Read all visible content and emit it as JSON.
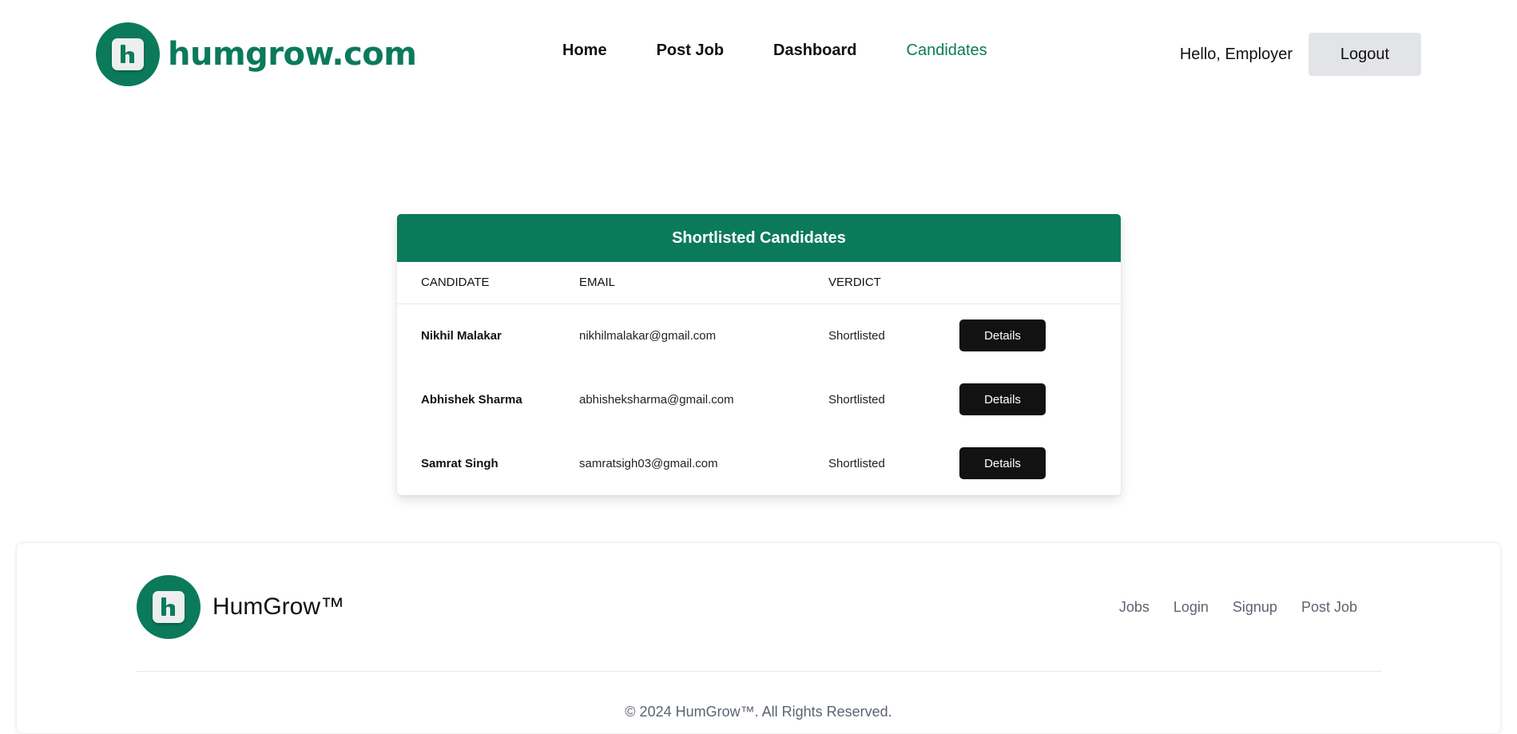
{
  "header": {
    "brand_name": "humgrow.com",
    "nav": [
      {
        "label": "Home"
      },
      {
        "label": "Post Job"
      },
      {
        "label": "Dashboard"
      },
      {
        "label": "Candidates"
      }
    ],
    "active_nav": "Candidates",
    "greeting": "Hello, Employer",
    "logout_label": "Logout"
  },
  "card": {
    "title": "Shortlisted Candidates",
    "columns": [
      "CANDIDATE",
      "EMAIL",
      "VERDICT"
    ],
    "rows": [
      {
        "name": "Nikhil Malakar",
        "email": "nikhilmalakar@gmail.com",
        "verdict": "Shortlisted",
        "action": "Details"
      },
      {
        "name": "Abhishek Sharma",
        "email": "abhisheksharma@gmail.com",
        "verdict": "Shortlisted",
        "action": "Details"
      },
      {
        "name": "Samrat Singh",
        "email": "samratsigh03@gmail.com",
        "verdict": "Shortlisted",
        "action": "Details"
      }
    ]
  },
  "footer": {
    "brand_name": "HumGrow™",
    "links": [
      {
        "label": "Jobs"
      },
      {
        "label": "Login"
      },
      {
        "label": "Signup"
      },
      {
        "label": "Post Job"
      }
    ],
    "copyright": "© 2024 HumGrow™. All Rights Reserved."
  },
  "colors": {
    "brand": "#0b7a5b",
    "button_dark": "#121212",
    "logout_bg": "#e3e4e8"
  },
  "icons": {
    "logo": "h-letter-logo-icon"
  }
}
